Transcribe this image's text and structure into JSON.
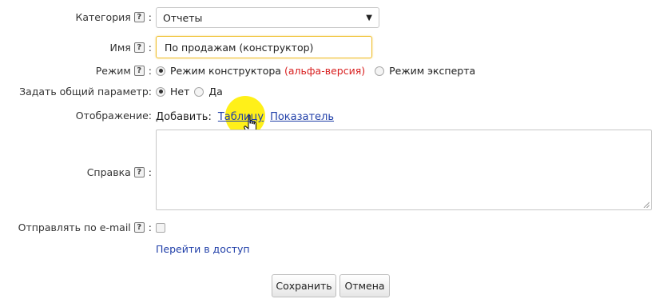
{
  "category": {
    "label": "Категория",
    "value": "Отчеты"
  },
  "name": {
    "label": "Имя",
    "value": "По продажам (конструктор)"
  },
  "mode": {
    "label": "Режим",
    "constructor_label": "Режим конструктора",
    "alpha_note": "(альфа-версия)",
    "expert_label": "Режим эксперта",
    "selected": "constructor"
  },
  "common_param": {
    "label": "Задать общий параметр:",
    "no_label": "Нет",
    "yes_label": "Да",
    "selected": "no"
  },
  "display": {
    "label": "Отображение:",
    "add_label": "Добавить:",
    "table_link": "Таблицу",
    "indicator_link": "Показатель"
  },
  "help": {
    "label": "Справка",
    "value": ""
  },
  "email": {
    "label": "Отправлять по e-mail",
    "checked": false
  },
  "access_link": "Перейти в доступ",
  "help_glyph": "?",
  "colon": ":",
  "buttons": {
    "save": "Сохранить",
    "cancel": "Отмена"
  },
  "icons": {
    "help": "help-question-icon",
    "dropdown": "chevron-down-icon",
    "cursor": "hand-pointer-icon"
  },
  "colors": {
    "highlight": "#ffee00",
    "link": "#1f3ea8",
    "alpha": "#d81e1e",
    "focus_border": "#f0c030"
  }
}
